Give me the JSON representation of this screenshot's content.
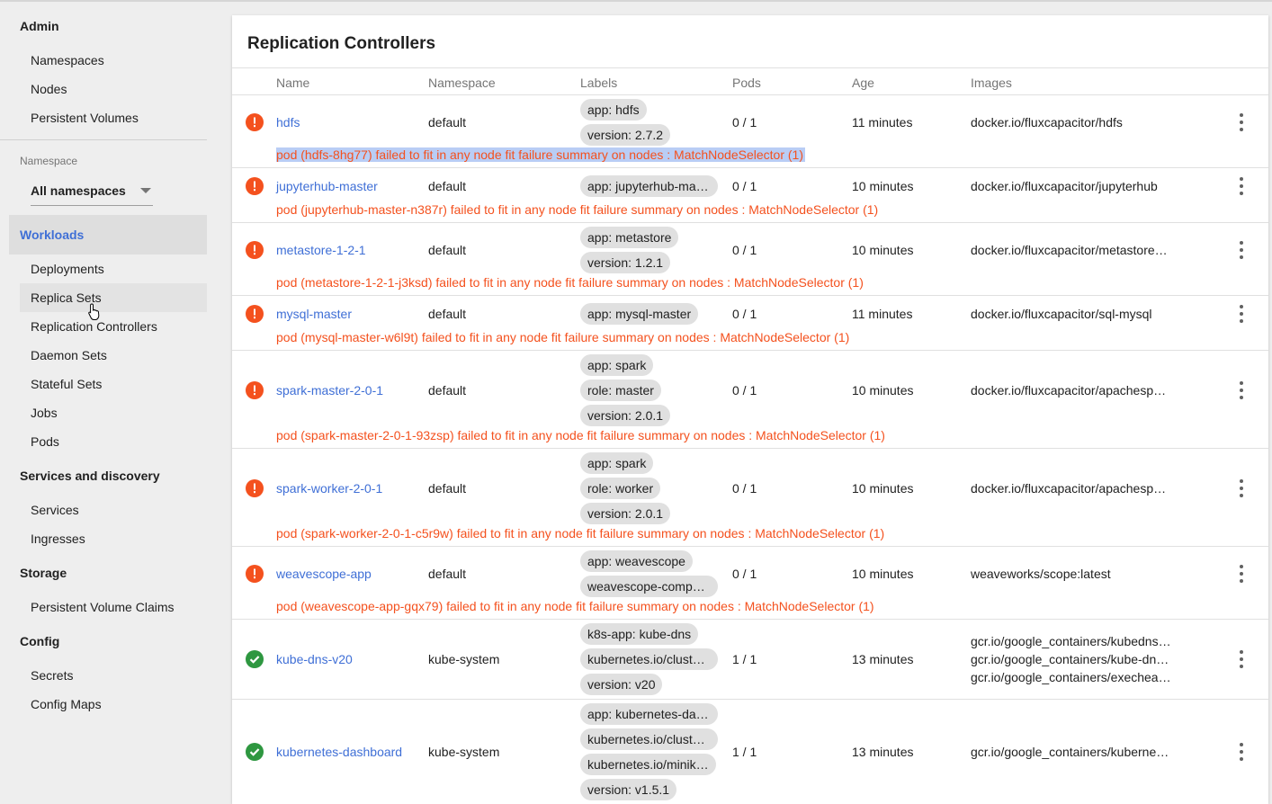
{
  "sidebar": {
    "admin": {
      "heading": "Admin",
      "items": [
        "Namespaces",
        "Nodes",
        "Persistent Volumes"
      ]
    },
    "namespace": {
      "label": "Namespace",
      "selected": "All namespaces"
    },
    "workloads": {
      "heading": "Workloads",
      "items": [
        "Deployments",
        "Replica Sets",
        "Replication Controllers",
        "Daemon Sets",
        "Stateful Sets",
        "Jobs",
        "Pods"
      ]
    },
    "services": {
      "heading": "Services and discovery",
      "items": [
        "Services",
        "Ingresses"
      ]
    },
    "storage": {
      "heading": "Storage",
      "items": [
        "Persistent Volume Claims"
      ]
    },
    "config": {
      "heading": "Config",
      "items": [
        "Secrets",
        "Config Maps"
      ]
    }
  },
  "card": {
    "title": "Replication Controllers",
    "columns": {
      "name": "Name",
      "namespace": "Namespace",
      "labels": "Labels",
      "pods": "Pods",
      "age": "Age",
      "images": "Images"
    },
    "rows": [
      {
        "status": "error",
        "name": "hdfs",
        "namespace": "default",
        "labels": [
          "app: hdfs",
          "version: 2.7.2"
        ],
        "pods": "0 / 1",
        "age": "11 minutes",
        "images": [
          "docker.io/fluxcapacitor/hdfs"
        ],
        "message": "pod (hdfs-8hg77) failed to fit in any node fit failure summary on nodes : MatchNodeSelector (1)"
      },
      {
        "status": "error",
        "name": "jupyterhub-master",
        "namespace": "default",
        "labels": [
          "app: jupyterhub-mas…"
        ],
        "pods": "0 / 1",
        "age": "10 minutes",
        "images": [
          "docker.io/fluxcapacitor/jupyterhub"
        ],
        "message": "pod (jupyterhub-master-n387r) failed to fit in any node fit failure summary on nodes : MatchNodeSelector (1)"
      },
      {
        "status": "error",
        "name": "metastore-1-2-1",
        "namespace": "default",
        "labels": [
          "app: metastore",
          "version: 1.2.1"
        ],
        "pods": "0 / 1",
        "age": "10 minutes",
        "images": [
          "docker.io/fluxcapacitor/metastore…"
        ],
        "message": "pod (metastore-1-2-1-j3ksd) failed to fit in any node fit failure summary on nodes : MatchNodeSelector (1)"
      },
      {
        "status": "error",
        "name": "mysql-master",
        "namespace": "default",
        "labels": [
          "app: mysql-master"
        ],
        "pods": "0 / 1",
        "age": "11 minutes",
        "images": [
          "docker.io/fluxcapacitor/sql-mysql"
        ],
        "message": "pod (mysql-master-w6l9t) failed to fit in any node fit failure summary on nodes : MatchNodeSelector (1)"
      },
      {
        "status": "error",
        "name": "spark-master-2-0-1",
        "namespace": "default",
        "labels": [
          "app: spark",
          "role: master",
          "version: 2.0.1"
        ],
        "pods": "0 / 1",
        "age": "10 minutes",
        "images": [
          "docker.io/fluxcapacitor/apachesp…"
        ],
        "message": "pod (spark-master-2-0-1-93zsp) failed to fit in any node fit failure summary on nodes : MatchNodeSelector (1)"
      },
      {
        "status": "error",
        "name": "spark-worker-2-0-1",
        "namespace": "default",
        "labels": [
          "app: spark",
          "role: worker",
          "version: 2.0.1"
        ],
        "pods": "0 / 1",
        "age": "10 minutes",
        "images": [
          "docker.io/fluxcapacitor/apachesp…"
        ],
        "message": "pod (spark-worker-2-0-1-c5r9w) failed to fit in any node fit failure summary on nodes : MatchNodeSelector (1)"
      },
      {
        "status": "error",
        "name": "weavescope-app",
        "namespace": "default",
        "labels": [
          "app: weavescope",
          "weavescope-compo…"
        ],
        "pods": "0 / 1",
        "age": "10 minutes",
        "images": [
          "weaveworks/scope:latest"
        ],
        "message": "pod (weavescope-app-gqx79) failed to fit in any node fit failure summary on nodes : MatchNodeSelector (1)"
      },
      {
        "status": "ok",
        "name": "kube-dns-v20",
        "namespace": "kube-system",
        "labels": [
          "k8s-app: kube-dns",
          "kubernetes.io/cluste…",
          "version: v20"
        ],
        "pods": "1 / 1",
        "age": "13 minutes",
        "images": [
          "gcr.io/google_containers/kubedns…",
          "gcr.io/google_containers/kube-dn…",
          "gcr.io/google_containers/execheа…"
        ],
        "message": ""
      },
      {
        "status": "ok",
        "name": "kubernetes-dashboard",
        "namespace": "kube-system",
        "labels": [
          "app: kubernetes-das…",
          "kubernetes.io/cluste…",
          "kubernetes.io/minik…",
          "version: v1.5.1"
        ],
        "pods": "1 / 1",
        "age": "13 minutes",
        "images": [
          "gcr.io/google_containers/kuberne…"
        ],
        "message": ""
      }
    ]
  },
  "colors": {
    "accent": "#3f6fd6",
    "error": "#f4511e",
    "success": "#2e9740",
    "selection": "#b9cdf5"
  },
  "icons": {
    "error": "exclamation-circle-icon",
    "ok": "check-circle-icon",
    "menu": "more-vert-icon",
    "caret": "arrow-drop-down-icon",
    "cursor": "hand-pointer-icon"
  }
}
